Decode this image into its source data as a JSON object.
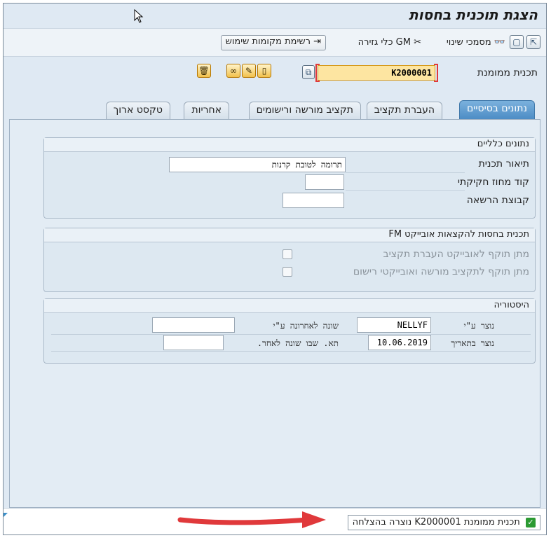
{
  "title": "הצגת תוכנית בחסות",
  "toolbar": {
    "btn_list": "רשימת מקומות שימוש",
    "gm_tools": "GM כלי גזירה",
    "change_docs": "מסמכי שינוי",
    "icons": [
      "other-object-icon",
      "display-change-icon",
      "documents-icon",
      "copy-icon",
      "cut-tool-icon",
      "list-export-icon"
    ]
  },
  "header": {
    "program_label": "תכנית ממומנת",
    "program_value": "K2000001"
  },
  "tabs": [
    "נתונים בסיסיים",
    "העברת תקציב",
    "תקציב מורשה ורישומים",
    "אחריות",
    "טקסט ארוך"
  ],
  "general": {
    "heading": "נתונים כלליים",
    "desc_label": "תיאור תכנית",
    "desc_value": "תרומה לטובת קרנות",
    "legal_label": "קוד מחוז חקיקתי",
    "legal_value": "",
    "auth_label": "קבוצת הרשאה",
    "auth_value": ""
  },
  "fm": {
    "heading": "תכנית בחסות להקצאות אובייקט FM",
    "row1": "מתן תוקף לאובייקט העברת תקציב",
    "row2": "מתן תוקף לתקציב מורשה ואובייקטי רישום"
  },
  "history": {
    "heading": "היסטוריה",
    "created_by_label": "נוצר ע\"י",
    "created_by_value": "NELLYF",
    "created_on_label": "נוצר בתאריך",
    "created_on_value": "10.06.2019",
    "changed_by_label": "שונה לאחרונה ע\"י",
    "changed_by_value": "",
    "changed_on_label": "תא. שבו שונה לאחר.",
    "changed_on_value": ""
  },
  "status": {
    "message": "תכנית ממומנת K2000001 נוצרה בהצלחה"
  },
  "colors": {
    "accent": "#4b8bc4",
    "highlight": "#fde5a1",
    "arrow": "#e0393b",
    "success": "#2b9a32"
  }
}
